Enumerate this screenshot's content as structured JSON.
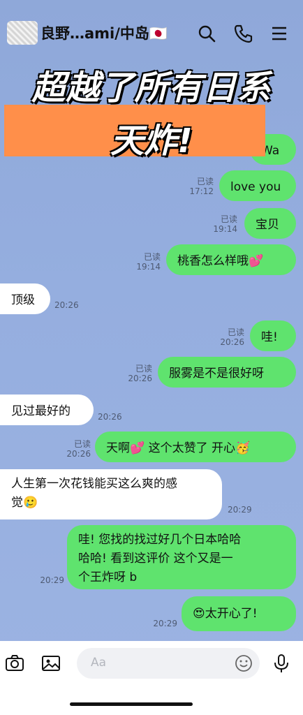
{
  "header": {
    "title": "良野…ami/中岛🇯🇵",
    "icons": [
      "search-icon",
      "phone-icon",
      "menu-icon"
    ]
  },
  "overlay": {
    "line1": "超越了所有日系",
    "line2": "天炸!"
  },
  "messages": [
    {
      "dir": "out",
      "text": "Wa",
      "read": "",
      "time": ""
    },
    {
      "dir": "out",
      "text": "love you",
      "read": "已读",
      "time": "17:12"
    },
    {
      "dir": "out",
      "text": "宝贝",
      "read": "已读",
      "time": "19:14"
    },
    {
      "dir": "out",
      "text": "桃香怎么样哦",
      "emoji": "💕",
      "read": "已读",
      "time": "19:14"
    },
    {
      "dir": "in",
      "text": "顶级",
      "time": "20:26"
    },
    {
      "dir": "out",
      "text": "哇!",
      "read": "已读",
      "time": "20:26"
    },
    {
      "dir": "out",
      "text": "服雾是不是很好呀",
      "read": "已读",
      "time": "20:26"
    },
    {
      "dir": "in",
      "text": "见过最好的",
      "time": "20:26"
    },
    {
      "dir": "out",
      "text_a": "天啊",
      "emoji_a": "💕",
      "text_b": " 这个太赞了 开心",
      "emoji_b": "🥳",
      "read": "已读",
      "time": "20:26"
    },
    {
      "dir": "in",
      "line1": "人生第一次花钱能买这么爽的感",
      "line2": "觉",
      "emoji": "🥲",
      "time": "20:29"
    },
    {
      "dir": "out",
      "line1": "哇!  您找的找过好几个日本哈哈",
      "line2": "哈哈!  看到这评价 这个又是一",
      "line3": "个王炸呀 b",
      "time": "20:29"
    },
    {
      "dir": "out",
      "emoji": "😍",
      "text": "太开心了!",
      "time": "20:29"
    }
  ],
  "composer": {
    "placeholder": "Aa",
    "icons": [
      "camera-icon",
      "image-icon",
      "emoji-icon",
      "microphone-icon"
    ]
  },
  "colors": {
    "outgoing": "#5fe36e",
    "incoming": "#ffffff",
    "banner": "#ff8f4a",
    "background": "#95aedf"
  }
}
